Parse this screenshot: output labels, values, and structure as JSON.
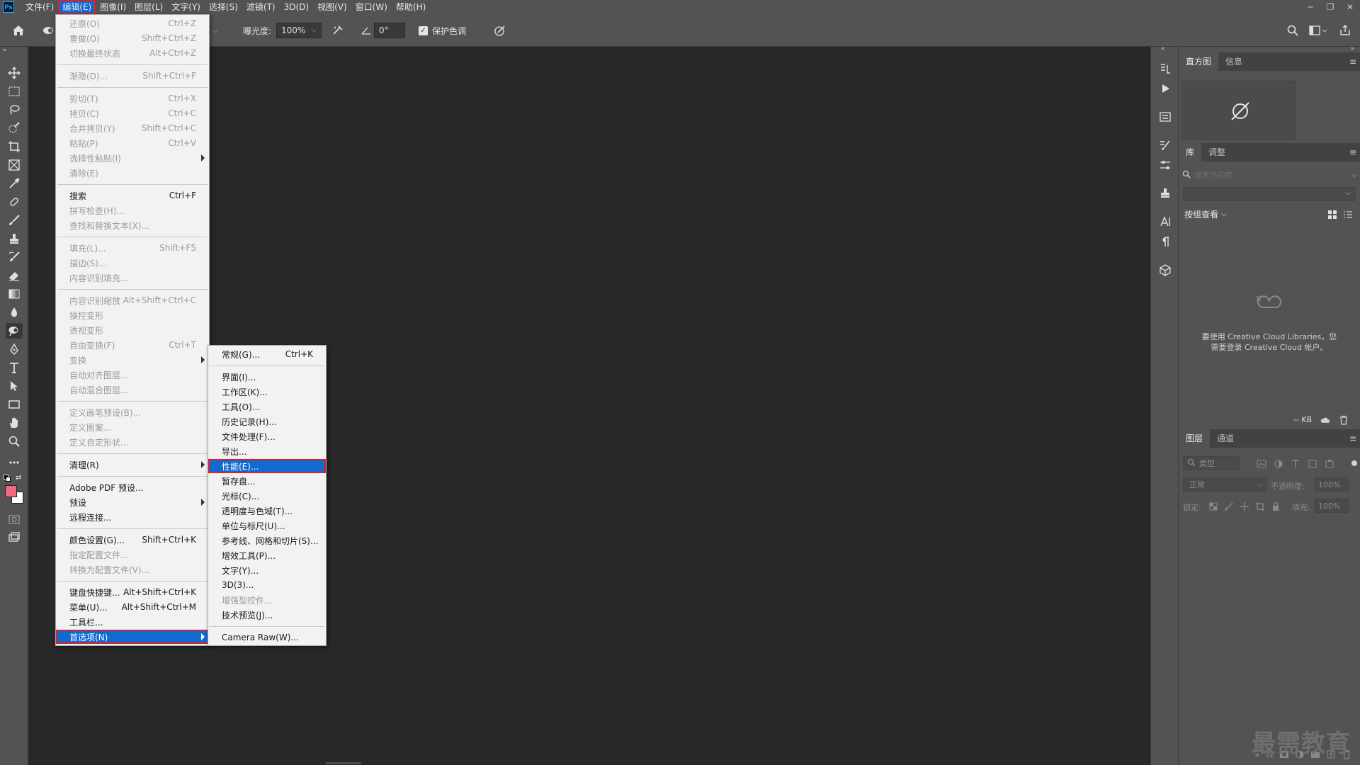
{
  "menubar": {
    "logo": "Ps",
    "items": [
      "文件(F)",
      "编辑(E)",
      "图像(I)",
      "图层(L)",
      "文字(Y)",
      "选择(S)",
      "滤镜(T)",
      "3D(D)",
      "视图(V)",
      "窗口(W)",
      "帮助(H)"
    ],
    "active_index": 1
  },
  "optbar": {
    "exposure_label": "曝光度:",
    "exposure_value": "100%",
    "angle_value": "0°",
    "protect_tones_label": "保护色调",
    "protect_tones_checked": true
  },
  "edit_menu": {
    "items": [
      {
        "label": "还原(O)",
        "shortcut": "Ctrl+Z",
        "disabled": true
      },
      {
        "label": "重做(O)",
        "shortcut": "Shift+Ctrl+Z",
        "disabled": true
      },
      {
        "label": "切换最终状态",
        "shortcut": "Alt+Ctrl+Z",
        "disabled": true
      },
      {
        "sep": true
      },
      {
        "label": "渐隐(D)...",
        "shortcut": "Shift+Ctrl+F",
        "disabled": true
      },
      {
        "sep": true
      },
      {
        "label": "剪切(T)",
        "shortcut": "Ctrl+X",
        "disabled": true
      },
      {
        "label": "拷贝(C)",
        "shortcut": "Ctrl+C",
        "disabled": true
      },
      {
        "label": "合并拷贝(Y)",
        "shortcut": "Shift+Ctrl+C",
        "disabled": true
      },
      {
        "label": "粘贴(P)",
        "shortcut": "Ctrl+V",
        "disabled": true
      },
      {
        "label": "选择性粘贴(I)",
        "shortcut": "",
        "disabled": true,
        "submenu": true
      },
      {
        "label": "清除(E)",
        "shortcut": "",
        "disabled": true
      },
      {
        "sep": true
      },
      {
        "label": "搜索",
        "shortcut": "Ctrl+F",
        "disabled": false
      },
      {
        "label": "拼写检查(H)...",
        "shortcut": "",
        "disabled": true
      },
      {
        "label": "查找和替换文本(X)...",
        "shortcut": "",
        "disabled": true
      },
      {
        "sep": true
      },
      {
        "label": "填充(L)...",
        "shortcut": "Shift+F5",
        "disabled": true
      },
      {
        "label": "描边(S)...",
        "shortcut": "",
        "disabled": true
      },
      {
        "label": "内容识别填充...",
        "shortcut": "",
        "disabled": true
      },
      {
        "sep": true
      },
      {
        "label": "内容识别缩放",
        "shortcut": "Alt+Shift+Ctrl+C",
        "disabled": true
      },
      {
        "label": "操控变形",
        "shortcut": "",
        "disabled": true
      },
      {
        "label": "透视变形",
        "shortcut": "",
        "disabled": true
      },
      {
        "label": "自由变换(F)",
        "shortcut": "Ctrl+T",
        "disabled": true
      },
      {
        "label": "变换",
        "shortcut": "",
        "disabled": true,
        "submenu": true
      },
      {
        "label": "自动对齐图层...",
        "shortcut": "",
        "disabled": true
      },
      {
        "label": "自动混合图层...",
        "shortcut": "",
        "disabled": true
      },
      {
        "sep": true
      },
      {
        "label": "定义画笔预设(B)...",
        "shortcut": "",
        "disabled": true
      },
      {
        "label": "定义图案...",
        "shortcut": "",
        "disabled": true
      },
      {
        "label": "定义自定形状...",
        "shortcut": "",
        "disabled": true
      },
      {
        "sep": true
      },
      {
        "label": "清理(R)",
        "shortcut": "",
        "disabled": false,
        "submenu": true
      },
      {
        "sep": true
      },
      {
        "label": "Adobe PDF 预设...",
        "shortcut": "",
        "disabled": false
      },
      {
        "label": "预设",
        "shortcut": "",
        "disabled": false,
        "submenu": true
      },
      {
        "label": "远程连接...",
        "shortcut": "",
        "disabled": false
      },
      {
        "sep": true
      },
      {
        "label": "颜色设置(G)...",
        "shortcut": "Shift+Ctrl+K",
        "disabled": false
      },
      {
        "label": "指定配置文件...",
        "shortcut": "",
        "disabled": true
      },
      {
        "label": "转换为配置文件(V)...",
        "shortcut": "",
        "disabled": true
      },
      {
        "sep": true
      },
      {
        "label": "键盘快捷键...",
        "shortcut": "Alt+Shift+Ctrl+K",
        "disabled": false
      },
      {
        "label": "菜单(U)...",
        "shortcut": "Alt+Shift+Ctrl+M",
        "disabled": false
      },
      {
        "label": "工具栏...",
        "shortcut": "",
        "disabled": false
      },
      {
        "label": "首选项(N)",
        "shortcut": "",
        "disabled": false,
        "submenu": true,
        "highlight": true
      }
    ]
  },
  "prefs_menu": {
    "items": [
      {
        "label": "常规(G)...",
        "shortcut": "Ctrl+K",
        "disabled": false
      },
      {
        "sep": true
      },
      {
        "label": "界面(I)...",
        "shortcut": "",
        "disabled": false
      },
      {
        "label": "工作区(K)...",
        "shortcut": "",
        "disabled": false
      },
      {
        "label": "工具(O)...",
        "shortcut": "",
        "disabled": false
      },
      {
        "label": "历史记录(H)...",
        "shortcut": "",
        "disabled": false
      },
      {
        "label": "文件处理(F)...",
        "shortcut": "",
        "disabled": false
      },
      {
        "label": "导出...",
        "shortcut": "",
        "disabled": false
      },
      {
        "label": "性能(E)...",
        "shortcut": "",
        "disabled": false,
        "highlight": true
      },
      {
        "label": "暂存盘...",
        "shortcut": "",
        "disabled": false
      },
      {
        "label": "光标(C)...",
        "shortcut": "",
        "disabled": false
      },
      {
        "label": "透明度与色域(T)...",
        "shortcut": "",
        "disabled": false
      },
      {
        "label": "单位与标尺(U)...",
        "shortcut": "",
        "disabled": false
      },
      {
        "label": "参考线、网格和切片(S)...",
        "shortcut": "",
        "disabled": false
      },
      {
        "label": "增效工具(P)...",
        "shortcut": "",
        "disabled": false
      },
      {
        "label": "文字(Y)...",
        "shortcut": "",
        "disabled": false
      },
      {
        "label": "3D(3)...",
        "shortcut": "",
        "disabled": false
      },
      {
        "label": "增强型控件...",
        "shortcut": "",
        "disabled": true
      },
      {
        "label": "技术预览(J)...",
        "shortcut": "",
        "disabled": false
      },
      {
        "sep": true
      },
      {
        "label": "Camera Raw(W)...",
        "shortcut": "",
        "disabled": false
      }
    ]
  },
  "panels": {
    "histogram_tabs": [
      "直方图",
      "信息"
    ],
    "library_tabs": [
      "库",
      "调整"
    ],
    "library_search_placeholder": "搜索当前库",
    "group_view_label": "按组查看",
    "cc_message_line1": "要使用 Creative Cloud Libraries，您",
    "cc_message_line2": "需要登录 Creative Cloud 帐户。",
    "kb_label": "-- KB",
    "layers_tabs": [
      "图层",
      "通道"
    ],
    "layer_filter_label": "类型",
    "blend_mode": "正常",
    "opacity_label": "不透明度:",
    "opacity_value": "100%",
    "lock_label": "锁定:",
    "fill_label": "填充:",
    "fill_value": "100%"
  },
  "colors": {
    "foreground": "#f06a7d",
    "background": "#ffffff",
    "highlight": "#0f6ad4",
    "annotation_outline": "#e02020"
  },
  "watermark": "最需教育"
}
